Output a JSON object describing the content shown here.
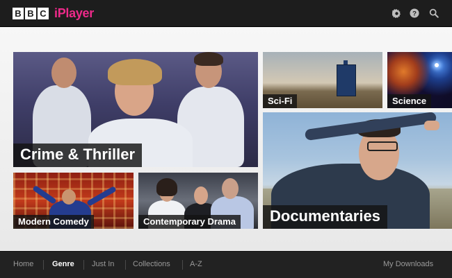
{
  "header": {
    "logo_bbc": [
      "B",
      "B",
      "C"
    ],
    "logo_iplayer": "iPlayer",
    "icons": [
      "settings-gear-icon",
      "help-question-icon",
      "search-icon"
    ]
  },
  "tiles": [
    {
      "key": "crime",
      "label": "Crime & Thriller"
    },
    {
      "key": "scifi",
      "label": "Sci-Fi"
    },
    {
      "key": "science",
      "label": "Science"
    },
    {
      "key": "comedy",
      "label": "Modern Comedy"
    },
    {
      "key": "drama",
      "label": "Contemporary Drama"
    },
    {
      "key": "docs",
      "label": "Documentaries"
    }
  ],
  "nav": {
    "left": [
      {
        "label": "Home",
        "active": false
      },
      {
        "label": "Genre",
        "active": true
      },
      {
        "label": "Just In",
        "active": false
      },
      {
        "label": "Collections",
        "active": false
      },
      {
        "label": "A-Z",
        "active": false
      }
    ],
    "right": {
      "label": "My Downloads"
    }
  },
  "colors": {
    "brand_pink": "#ee2a8a",
    "header_bg": "#1d1d1d",
    "footer_bg": "#222222"
  }
}
